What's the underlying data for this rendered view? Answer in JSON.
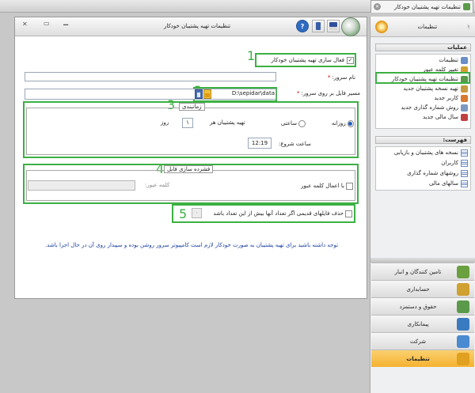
{
  "tab": {
    "title": "تنظیمات تهیه پشتیبان خودکار"
  },
  "window": {
    "title": "تنظیمات تهیه پشتیبان خودکار",
    "help_glyph": "?"
  },
  "form": {
    "enable_label": "فعال سازی تهیه پشتیبان خودکار",
    "enable_checked": true,
    "server_name_label": "نام سرور:",
    "server_name_value": "",
    "required_mark": "*",
    "path_label": "مسیر فایل بر روی  سرور:",
    "path_value": "D:\\sepidar\\data",
    "browse_glyph": "...",
    "schedule": {
      "legend": "زمانبندی",
      "daily_label": "روزانه",
      "hourly_label": "ساعتی",
      "every_label": "تهیه پشتیبان هر",
      "every_value": "۱",
      "day_unit": "روز",
      "start_label": "ساعت شروع:",
      "start_value": "12:19"
    },
    "compress": {
      "legend": "فشرده سازی فایل",
      "password_check_label": "با اعمال کلمه عبور",
      "password_label": "کلمه عبور:"
    },
    "delete_old_label": "حذف فایلهای قدیمی اگر تعداد آنها بیش از این تعداد باشد",
    "delete_old_value": "۰",
    "note": "توجه داشته باشید برای تهیه پشتیبان به صورت خودکار لازم است کامپیوتر سرور روشن بوده و سپیدار روی آن در حال اجرا باشد."
  },
  "callouts": [
    "1",
    "2",
    "3",
    "4",
    "5"
  ],
  "sidebar": {
    "title": "تنظیمات",
    "pin_glyph": "ᛋ",
    "ops_header": "عملیات",
    "ops": [
      {
        "label": "تنظیمات",
        "icon": "settings-icon",
        "color": "#6a8fc8"
      },
      {
        "label": "تغییر کلمه عبور",
        "icon": "key-icon",
        "color": "#d0a030"
      },
      {
        "label": "تنظیمات تهیه پشتیبان خودکار",
        "icon": "auto-backup-icon",
        "color": "#5a9a4a"
      },
      {
        "label": "تهیه نسخه پشتیبان جدید",
        "icon": "backup-icon",
        "color": "#c89a40"
      },
      {
        "label": "کاربر جدید",
        "icon": "user-icon",
        "color": "#d87a30"
      },
      {
        "label": "روش شماره گذاری جدید",
        "icon": "numbering-icon",
        "color": "#7a9ac0"
      },
      {
        "label": "سال مالی جدید",
        "icon": "calendar-icon",
        "color": "#c04040"
      }
    ],
    "lists_header": "فهرست:",
    "lists": [
      {
        "label": "نسخه های پشتیبان و بازیابی",
        "icon": "list-icon"
      },
      {
        "label": "کاربران",
        "icon": "list-icon"
      },
      {
        "label": "روشهای شماره گذاری",
        "icon": "list-icon"
      },
      {
        "label": "سالهای مالی",
        "icon": "list-icon"
      }
    ],
    "modules": [
      {
        "label": "تامین کنندگان و انبار",
        "icon": "suppliers-icon",
        "color": "#6aa040"
      },
      {
        "label": "حسابداری",
        "icon": "accounting-icon",
        "color": "#d0a030"
      },
      {
        "label": "حقوق و دستمزد",
        "icon": "payroll-icon",
        "color": "#5a9a4a"
      },
      {
        "label": "پیمانکاری",
        "icon": "contracting-icon",
        "color": "#3a7ac0"
      },
      {
        "label": "شرکت",
        "icon": "company-icon",
        "color": "#4a8ad0"
      },
      {
        "label": "تنظیمات",
        "icon": "settings-module-icon",
        "color": "#e0a020"
      }
    ]
  },
  "colors": {
    "callout": "#3cb043",
    "active_module": "#f5b230",
    "required": "#cc0000"
  }
}
